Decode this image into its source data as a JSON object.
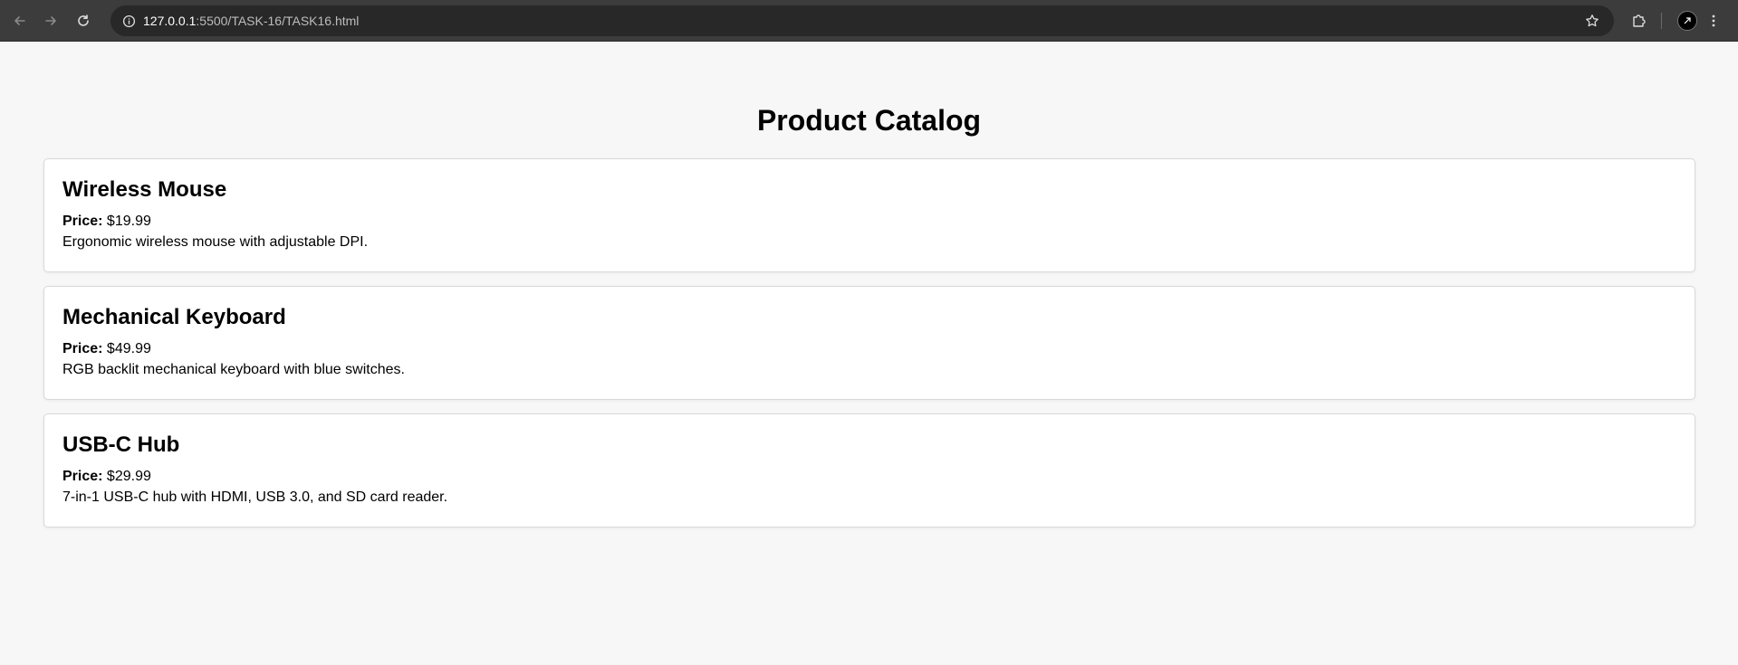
{
  "browser": {
    "url_host": "127.0.0.1",
    "url_path": ":5500/TASK-16/TASK16.html",
    "icons": {
      "back": "arrow-left-icon",
      "forward": "arrow-right-icon",
      "reload": "reload-icon",
      "site_info": "info-icon",
      "bookmark": "star-icon",
      "extensions": "puzzle-icon",
      "profile": "avatar",
      "menu": "kebab-menu-icon"
    },
    "colors": {
      "toolbar": "#3c3c3c",
      "omnibox": "#282828"
    }
  },
  "page": {
    "title": "Product Catalog",
    "background": "#f7f7f7"
  },
  "products": [
    {
      "name": "Wireless Mouse",
      "price_label": "Price:",
      "price": "$19.99",
      "description": "Ergonomic wireless mouse with adjustable DPI."
    },
    {
      "name": "Mechanical Keyboard",
      "price_label": "Price:",
      "price": "$49.99",
      "description": "RGB backlit mechanical keyboard with blue switches."
    },
    {
      "name": "USB-C Hub",
      "price_label": "Price:",
      "price": "$29.99",
      "description": "7-in-1 USB-C hub with HDMI, USB 3.0, and SD card reader."
    }
  ]
}
